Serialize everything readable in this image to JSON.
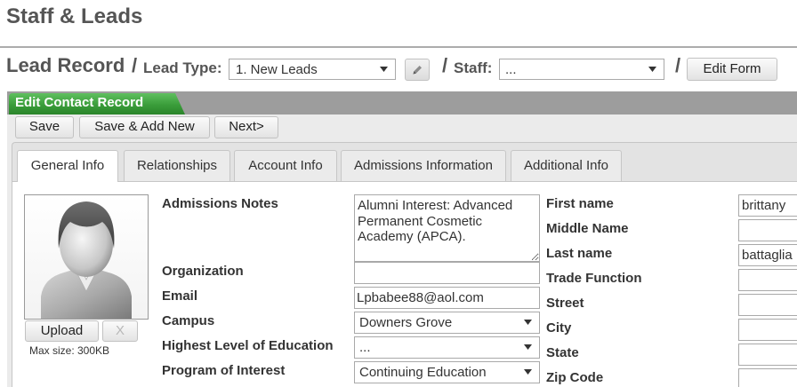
{
  "page": {
    "title": "Staff & Leads"
  },
  "lead_header": {
    "lead_record_label": "Lead Record",
    "separator": "/",
    "lead_type_label": "Lead Type:",
    "lead_type_value": "1. New Leads",
    "staff_label": "Staff:",
    "staff_value": "...",
    "edit_form_label": "Edit Form"
  },
  "panel": {
    "header_tab": "Edit Contact Record"
  },
  "toolbar": {
    "save_label": "Save",
    "save_add_new_label": "Save & Add New",
    "next_label": "Next>"
  },
  "tabs": [
    {
      "label": "General Info",
      "active": true
    },
    {
      "label": "Relationships",
      "active": false
    },
    {
      "label": "Account Info",
      "active": false
    },
    {
      "label": "Admissions Information",
      "active": false
    },
    {
      "label": "Additional Info",
      "active": false
    }
  ],
  "photo": {
    "upload_label": "Upload",
    "remove_label": "X",
    "max_size_note": "Max size: 300KB"
  },
  "left_form": {
    "admissions_notes": {
      "label": "Admissions Notes",
      "value": "Alumni Interest: Advanced Permanent Cosmetic Academy (APCA)."
    },
    "organization": {
      "label": "Organization",
      "value": ""
    },
    "email": {
      "label": "Email",
      "value": "Lpbabee88@aol.com"
    },
    "campus": {
      "label": "Campus",
      "value": "Downers Grove"
    },
    "education": {
      "label": "Highest Level of Education",
      "value": "..."
    },
    "program": {
      "label": "Program of Interest",
      "value": "Continuing Education"
    }
  },
  "right_form": {
    "first_name": {
      "label": "First name",
      "value": "brittany"
    },
    "middle_name": {
      "label": "Middle Name",
      "value": ""
    },
    "last_name": {
      "label": "Last name",
      "value": "battaglia"
    },
    "trade_function": {
      "label": "Trade Function",
      "value": ""
    },
    "street": {
      "label": "Street",
      "value": ""
    },
    "city": {
      "label": "City",
      "value": ""
    },
    "state": {
      "label": "State",
      "value": ""
    },
    "zip_code": {
      "label": "Zip Code",
      "value": ""
    }
  },
  "icons": {
    "edit_lead_type": "pencil-icon",
    "select_arrow": "chevron-down-icon",
    "avatar": "user-silhouette-icon"
  },
  "colors": {
    "accent_green": "#3a9d3a",
    "header_bar": "#9d9d9d",
    "title_text": "#555555"
  }
}
